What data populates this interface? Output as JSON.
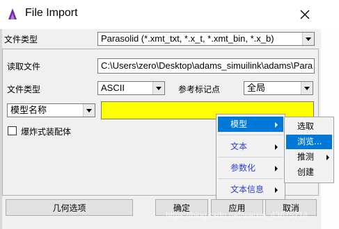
{
  "window": {
    "title": "File Import",
    "close_icon": "close-icon",
    "app_icon": "adams-logo-icon"
  },
  "top": {
    "file_type_label": "文件类型",
    "file_type_value": "Parasolid (*.xmt_txt, *.x_t, *.xmt_bin, *.x_b)"
  },
  "form": {
    "read_file_label": "读取文件",
    "read_file_value": "C:\\Users\\zero\\Desktop\\adams_simuilink\\adams\\Para",
    "file_type_label": "文件类型",
    "file_type_value": "ASCII",
    "ref_marker_label": "参考标记点",
    "ref_marker_value": "全局",
    "model_name_select": "模型名称",
    "model_name_value": "",
    "exploded_checkbox_label": "爆炸式装配体",
    "exploded_checked": false
  },
  "context_menu": {
    "items": [
      {
        "label": "模型",
        "has_submenu": true,
        "active": true
      },
      {
        "label": "文本",
        "has_submenu": true,
        "active": false
      },
      {
        "label": "参数化",
        "has_submenu": true,
        "active": false
      },
      {
        "label": "文本信息",
        "has_submenu": true,
        "active": false
      }
    ],
    "submenu": [
      {
        "label": "选取",
        "has_submenu": false,
        "highlighted": false
      },
      {
        "label": "浏览...",
        "has_submenu": false,
        "highlighted": true
      },
      {
        "label": "推测",
        "has_submenu": true,
        "highlighted": false
      },
      {
        "label": "创建",
        "has_submenu": false,
        "highlighted": false
      }
    ]
  },
  "buttons": {
    "geometry_options": "几何选项",
    "ok": "确定",
    "apply": "应用",
    "cancel": "取消"
  },
  "watermark": "https://blog.csdn.net/weixin_43675714",
  "colors": {
    "highlight": "#0078d7",
    "menu_text": "#2a3dd6",
    "model_field": "#ffff00"
  }
}
